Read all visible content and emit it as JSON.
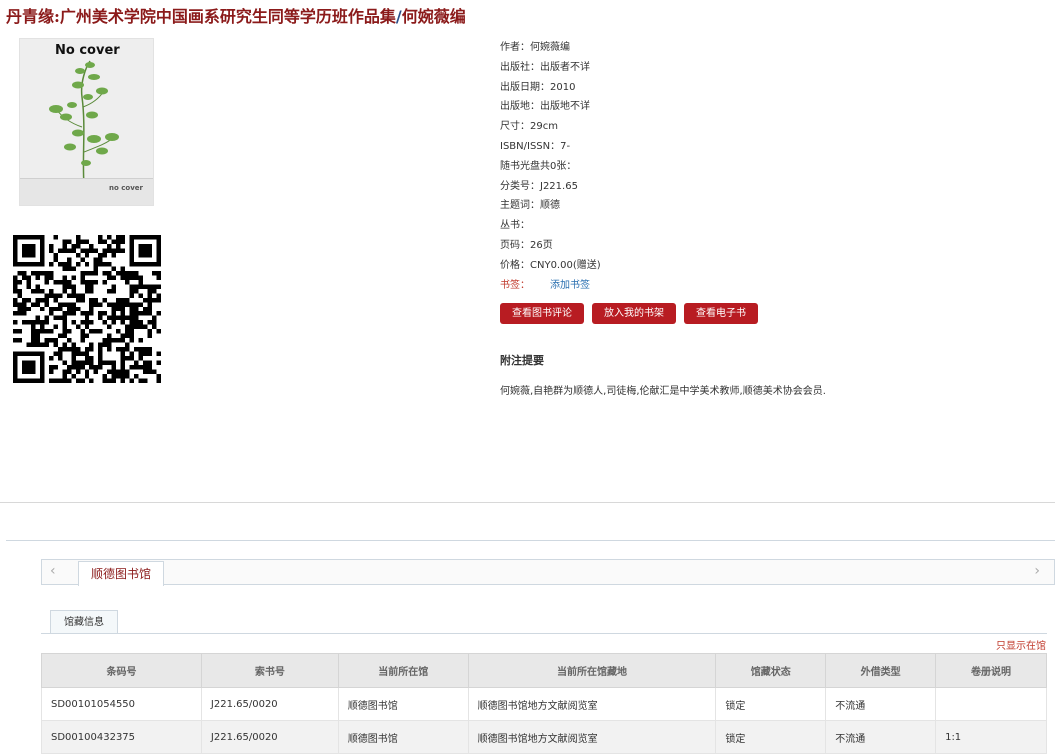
{
  "book": {
    "title": "丹青缘:广州美术学院中国画系研究生同等学历班作品集",
    "separator": "/",
    "author_line": "何婉薇编"
  },
  "cover": {
    "title": "No cover",
    "small_text": "no cover"
  },
  "details": [
    {
      "label": "作者：",
      "value": "何婉薇编"
    },
    {
      "label": "出版社：",
      "value": "出版者不详"
    },
    {
      "label": "出版日期：",
      "value": "2010"
    },
    {
      "label": "出版地：",
      "value": "出版地不详"
    },
    {
      "label": "尺寸：",
      "value": "29cm"
    },
    {
      "label": "ISBN/ISSN：",
      "value": "7-"
    },
    {
      "label": "随书光盘共0张：",
      "value": ""
    },
    {
      "label": "分类号：",
      "value": "J221.65"
    },
    {
      "label": "主题词：",
      "value": "顺德"
    },
    {
      "label": "丛书：",
      "value": ""
    },
    {
      "label": "页码：",
      "value": "26页"
    },
    {
      "label": "价格：",
      "value": "CNY0.00(赠送)"
    }
  ],
  "bookmark": {
    "label": "书签：",
    "link": "添加书签"
  },
  "buttons": {
    "reviews": "查看图书评论",
    "shelf": "放入我的书架",
    "ebook": "查看电子书"
  },
  "abstract": {
    "title": "附注提要",
    "text": "何婉薇,自艳群为顺德人,司徒梅,伦献汇是中学美术教师,顺德美术协会会员."
  },
  "library": {
    "tab_label": "顺德图书馆",
    "arrow_left": "‹",
    "arrow_right": "›",
    "sub_tab_label": "馆藏信息",
    "show_only": "只显示在馆"
  },
  "holdings": {
    "headers": [
      "条码号",
      "索书号",
      "当前所在馆",
      "当前所在馆藏地",
      "馆藏状态",
      "外借类型",
      "卷册说明"
    ],
    "rows": [
      [
        "SD00101054550",
        "J221.65/0020",
        "顺德图书馆",
        "顺德图书馆地方文献阅览室",
        "锁定",
        "不流通",
        ""
      ],
      [
        "SD00100432375",
        "J221.65/0020",
        "顺德图书馆",
        "顺德图书馆地方文献阅览室",
        "锁定",
        "不流通",
        "1:1"
      ]
    ]
  },
  "colors": {
    "title": "#8b1a1a",
    "button": "#b81c22",
    "link": "#2a6fb0"
  },
  "icons": {
    "qr": "qr-code-icon"
  }
}
